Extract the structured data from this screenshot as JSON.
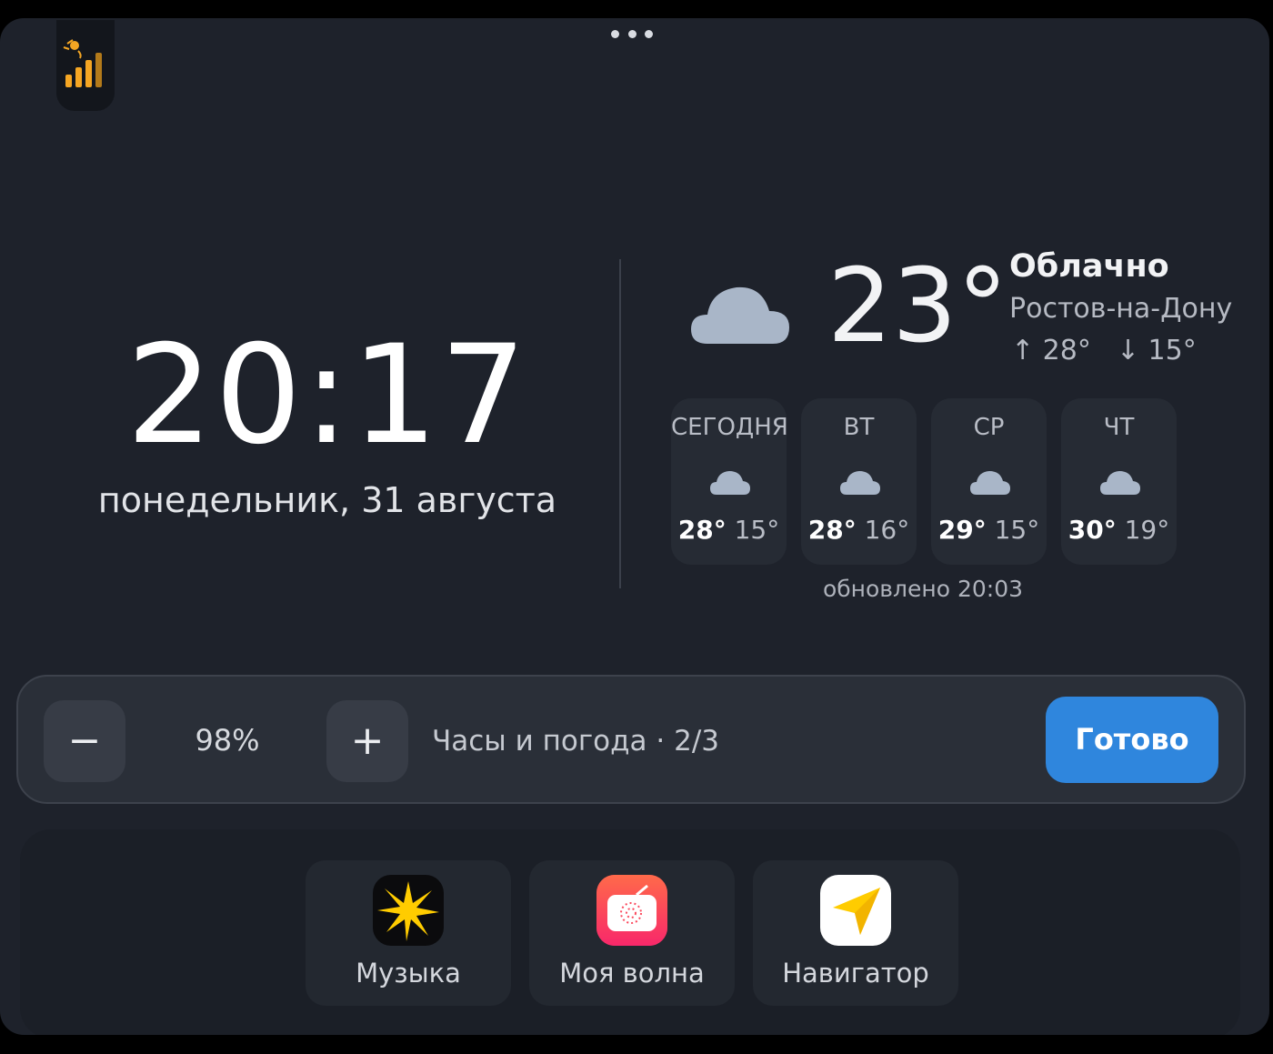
{
  "clock": {
    "time": "20:17",
    "date": "понедельник, 31 августа"
  },
  "weather": {
    "temperature": "23°",
    "condition": "Облачно",
    "city": "Ростов-на-Дону",
    "high": "↑ 28°",
    "low": "↓ 15°",
    "updated": "обновлено 20:03",
    "forecast": [
      {
        "day": "СЕГОДНЯ",
        "hi": "28°",
        "lo": "15°"
      },
      {
        "day": "ВТ",
        "hi": "28°",
        "lo": "16°"
      },
      {
        "day": "СР",
        "hi": "29°",
        "lo": "15°"
      },
      {
        "day": "ЧТ",
        "hi": "30°",
        "lo": "19°"
      }
    ]
  },
  "controls": {
    "minus": "−",
    "plus": "+",
    "percent": "98%",
    "widget_name": "Часы и погода · 2/3",
    "done": "Готово"
  },
  "dock": {
    "items": [
      {
        "label": "Музыка",
        "icon": "music-star-icon"
      },
      {
        "label": "Моя волна",
        "icon": "radio-icon"
      },
      {
        "label": "Навигатор",
        "icon": "navigator-arrow-icon"
      }
    ]
  },
  "colors": {
    "accent": "#2f86dd",
    "background": "#1e222b",
    "cloud": "#a9b6c8"
  }
}
